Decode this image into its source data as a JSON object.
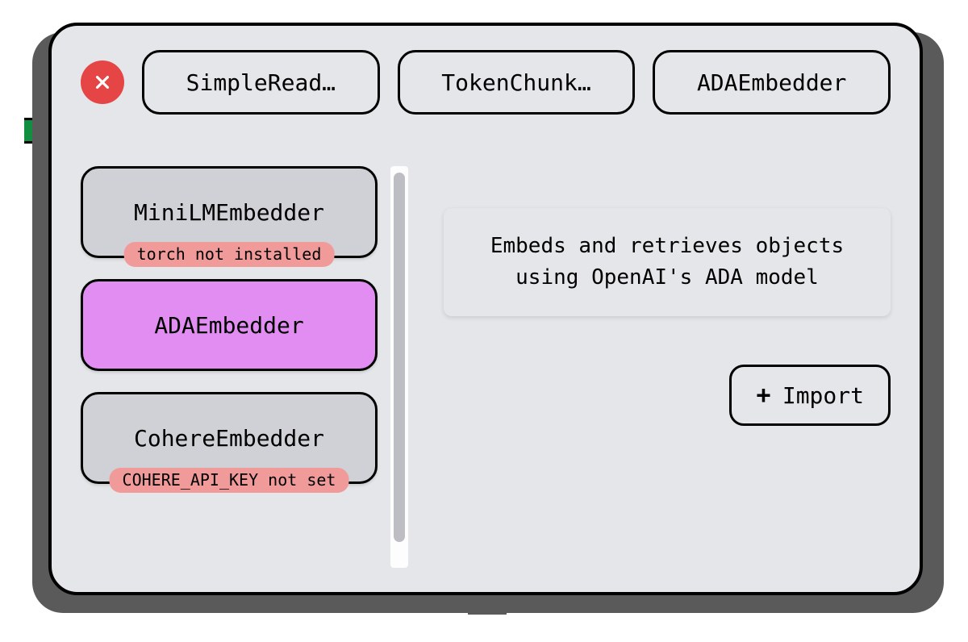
{
  "header": {
    "steps": [
      "SimpleRead…",
      "TokenChunk…",
      "ADAEmbedder"
    ]
  },
  "embedders": [
    {
      "name": "MiniLMEmbedder",
      "warning": "torch not installed",
      "selected": false
    },
    {
      "name": "ADAEmbedder",
      "warning": null,
      "selected": true
    },
    {
      "name": "CohereEmbedder",
      "warning": "COHERE_API_KEY not set",
      "selected": false
    }
  ],
  "description": "Embeds and retrieves objects using OpenAI's ADA model",
  "import_label": "Import"
}
